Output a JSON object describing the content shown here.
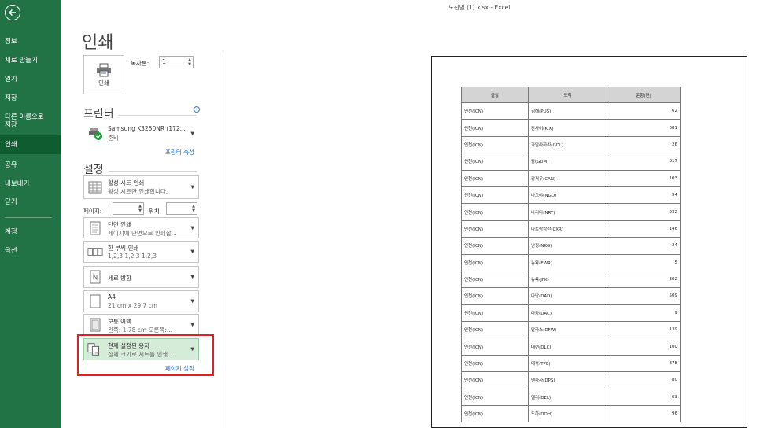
{
  "window_title": "노선별 (1).xlsx - Excel",
  "nav": {
    "items": [
      "정보",
      "새로 만들기",
      "열기",
      "저장",
      "다른 이름으로\n저장",
      "인쇄",
      "공유",
      "내보내기",
      "닫기",
      "계정",
      "옵션"
    ],
    "active": "인쇄"
  },
  "print": {
    "title": "인쇄",
    "button_label": "인쇄",
    "copies_label": "복사본:",
    "copies_value": "1"
  },
  "printer": {
    "heading": "프린터",
    "info_icon": "i",
    "name": "Samsung K3250NR (172...",
    "status": "준비",
    "properties_link": "프린터 속성"
  },
  "settings": {
    "heading": "설정",
    "print_what": {
      "line1": "활성 시트 인쇄",
      "line2": "활성 시트만 인쇄합니다."
    },
    "pages_label": "페이지:",
    "pages_to": "위치",
    "sides": {
      "line1": "단면 인쇄",
      "line2": "페이지에 단면으로 인쇄합..."
    },
    "collate": {
      "line1": "한 부씩 인쇄",
      "line2": "1,2,3    1,2,3    1,2,3"
    },
    "orientation": {
      "line1": "세로 방향"
    },
    "paper": {
      "line1": "A4",
      "line2": "21 cm x 29.7 cm"
    },
    "margins": {
      "line1": "보통 여백",
      "line2": "왼쪽:  1.78 cm    오른쪽:..."
    },
    "scaling": {
      "line1": "현재 설정된 용지",
      "line2": "실제 크기로 시트를 인쇄..."
    },
    "page_setup_link": "페이지 설정"
  },
  "preview": {
    "headers": [
      "출발",
      "도착",
      "운항(편)"
    ],
    "rows": [
      [
        "인천(ICN)",
        "김해(PUS)",
        "62"
      ],
      [
        "인천(ICN)",
        "간사이(KIX)",
        "681"
      ],
      [
        "인천(ICN)",
        "과달라하라(GDL)",
        "26"
      ],
      [
        "인천(ICN)",
        "괌(GUM)",
        "317"
      ],
      [
        "인천(ICN)",
        "광저우(CAN)",
        "103"
      ],
      [
        "인천(ICN)",
        "나고야(NGO)",
        "54"
      ],
      [
        "인천(ICN)",
        "나리타(NRT)",
        "932"
      ],
      [
        "인천(ICN)",
        "나트랑캄란(CXR)",
        "146"
      ],
      [
        "인천(ICN)",
        "난징(NKG)",
        "24"
      ],
      [
        "인천(ICN)",
        "뉴왁(EWR)",
        "5"
      ],
      [
        "인천(ICN)",
        "뉴욕(JFK)",
        "302"
      ],
      [
        "인천(ICN)",
        "다낭(DAD)",
        "509"
      ],
      [
        "인천(ICN)",
        "다카(DAC)",
        "9"
      ],
      [
        "인천(ICN)",
        "달라스(DFW)",
        "139"
      ],
      [
        "인천(ICN)",
        "대련(DLC)",
        "100"
      ],
      [
        "인천(ICN)",
        "대북(TPE)",
        "378"
      ],
      [
        "인천(ICN)",
        "덴파사(DPS)",
        "80"
      ],
      [
        "인천(ICN)",
        "델리(DEL)",
        "63"
      ],
      [
        "인천(ICN)",
        "도하(DOH)",
        "96"
      ]
    ]
  },
  "colors": {
    "nav_bg": "#217346",
    "nav_active": "#0e5c2f",
    "selected_bg": "#d5ecd9",
    "highlight": "#e02020",
    "link": "#2a6fc0"
  }
}
